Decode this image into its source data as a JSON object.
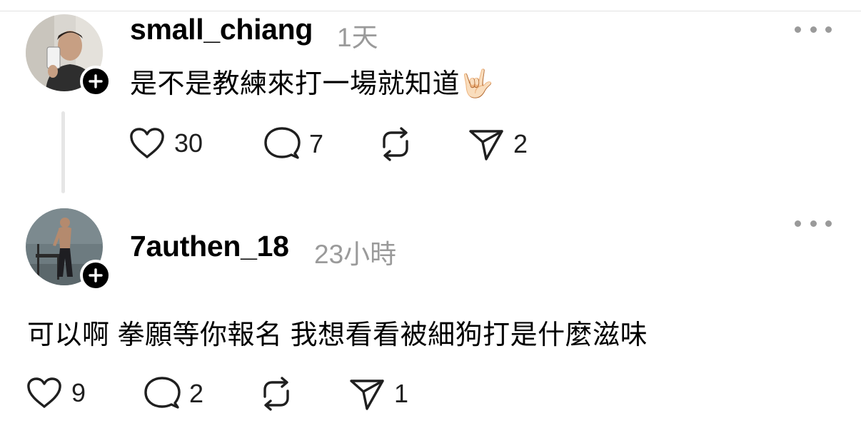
{
  "comments": [
    {
      "username": "small_chiang",
      "time": "1天",
      "text": "是不是教練來打一場就知道🤟🏻",
      "actions": {
        "likes": "30",
        "replies": "7",
        "reposts": "",
        "shares": "2"
      }
    },
    {
      "username": "7authen_18",
      "time": "23小時",
      "text": "可以啊 拳願等你報名 我想看看被細狗打是什麼滋味",
      "actions": {
        "likes": "9",
        "replies": "2",
        "reposts": "",
        "shares": "1"
      }
    }
  ],
  "icons": {
    "like": "heart-icon",
    "reply": "comment-bubble-icon",
    "repost": "repost-icon",
    "share": "send-icon",
    "more": "more-horizontal-icon",
    "follow": "plus-icon"
  },
  "colors": {
    "text": "#000000",
    "muted": "#9a9a9a",
    "divider": "#e3e3e3",
    "badge": "#000000"
  }
}
